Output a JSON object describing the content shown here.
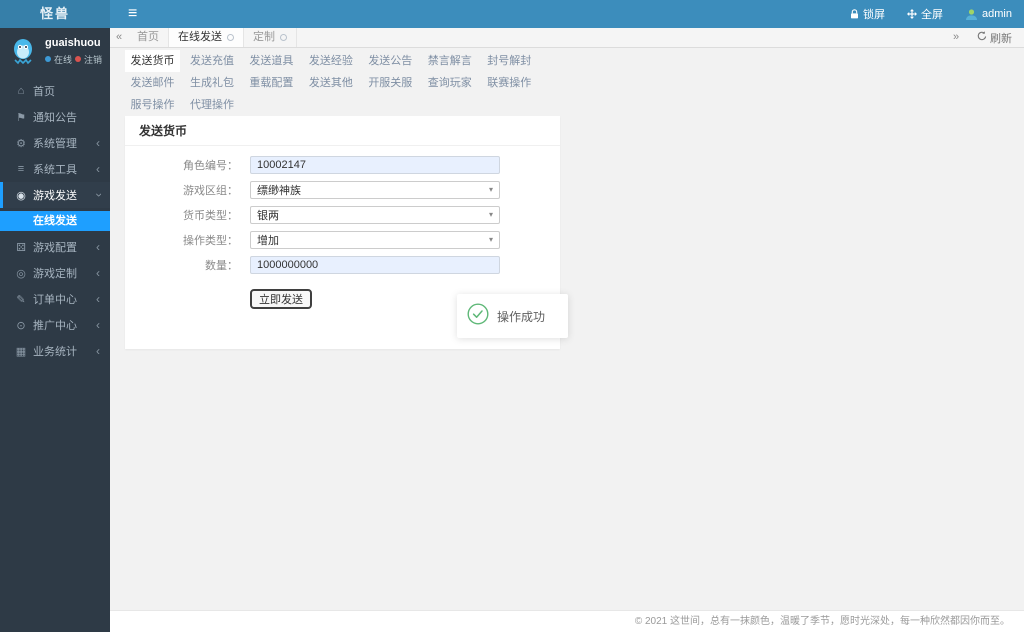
{
  "colors": {
    "header_blue": "#3c8dbc",
    "logo_blue": "#367fa9",
    "sidebar_dark": "#2e3a46",
    "active_blue": "#1e9fff",
    "success_green": "#5fb878",
    "autofill_blue": "#e8f0fe",
    "online_dot": "#3d9ad6",
    "logout_dot": "#d9534f"
  },
  "header": {
    "app_title": "怪兽",
    "lock_label": "锁屏",
    "fullscreen_label": "全屏",
    "username": "admin"
  },
  "sidebar": {
    "user": {
      "name": "guaishuou",
      "online_label": "在线",
      "logout_label": "注销"
    },
    "items": [
      {
        "label": "首页",
        "icon": "home-icon"
      },
      {
        "label": "通知公告",
        "icon": "bullhorn-icon"
      },
      {
        "label": "系统管理",
        "icon": "gear-icon",
        "expandable": true
      },
      {
        "label": "系统工具",
        "icon": "tools-icon",
        "expandable": true
      },
      {
        "label": "游戏发送",
        "icon": "gamepad-icon",
        "expandable": true,
        "expanded": true
      },
      {
        "label": "游戏配置",
        "icon": "dice-icon",
        "expandable": true
      },
      {
        "label": "游戏定制",
        "icon": "headset-icon",
        "expandable": true
      },
      {
        "label": "订单中心",
        "icon": "pencil-icon",
        "expandable": true
      },
      {
        "label": "推广中心",
        "icon": "eye-icon",
        "expandable": true
      },
      {
        "label": "业务统计",
        "icon": "chart-icon",
        "expandable": true
      }
    ],
    "submenu": {
      "label": "在线发送",
      "active": true
    }
  },
  "tabbar": {
    "tabs": [
      {
        "label": "首页"
      },
      {
        "label": "在线发送",
        "closable": true,
        "active": true
      },
      {
        "label": "定制",
        "closable": true
      }
    ],
    "refresh_label": "刷新"
  },
  "send_tabs": {
    "active": "发送货币",
    "items": [
      "发送货币",
      "发送充值",
      "发送道具",
      "发送经验",
      "发送公告",
      "禁言解言",
      "封号解封",
      "发送邮件",
      "生成礼包",
      "重载配置",
      "发送其他",
      "开服关服",
      "查询玩家",
      "联赛操作",
      "服号操作",
      "代理操作"
    ]
  },
  "form": {
    "title": "发送货币",
    "fields": [
      {
        "label": "角色编号：",
        "value": "10002147",
        "control": "input"
      },
      {
        "label": "游戏区组：",
        "value": "缥缈神族",
        "control": "select"
      },
      {
        "label": "货币类型：",
        "value": "银两",
        "control": "select"
      },
      {
        "label": "操作类型：",
        "value": "增加",
        "control": "select"
      },
      {
        "label": "数量：",
        "value": "1000000000",
        "control": "input"
      }
    ],
    "submit_label": "立即发送"
  },
  "toast": {
    "message": "操作成功"
  },
  "footer": {
    "copyright": "© 2021 这世间，总有一抹颜色，温暖了季节，愿时光深处，每一种欣然都因你而至。"
  }
}
